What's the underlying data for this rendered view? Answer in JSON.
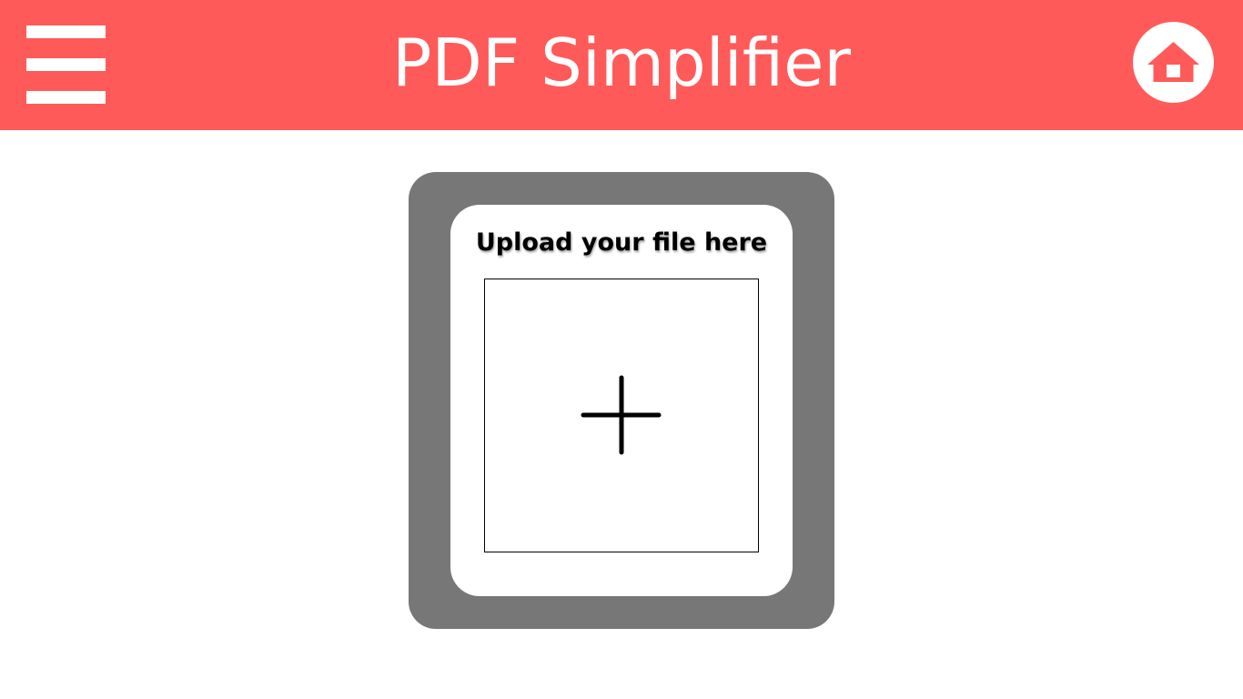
{
  "header": {
    "title": "PDF Simplifier",
    "menu_icon": "hamburger-menu-icon",
    "home_icon": "home-icon",
    "background_color": "#ff5a5a"
  },
  "upload": {
    "heading": "Upload your file here",
    "add_icon": "plus-icon",
    "frame_color": "#777777"
  }
}
